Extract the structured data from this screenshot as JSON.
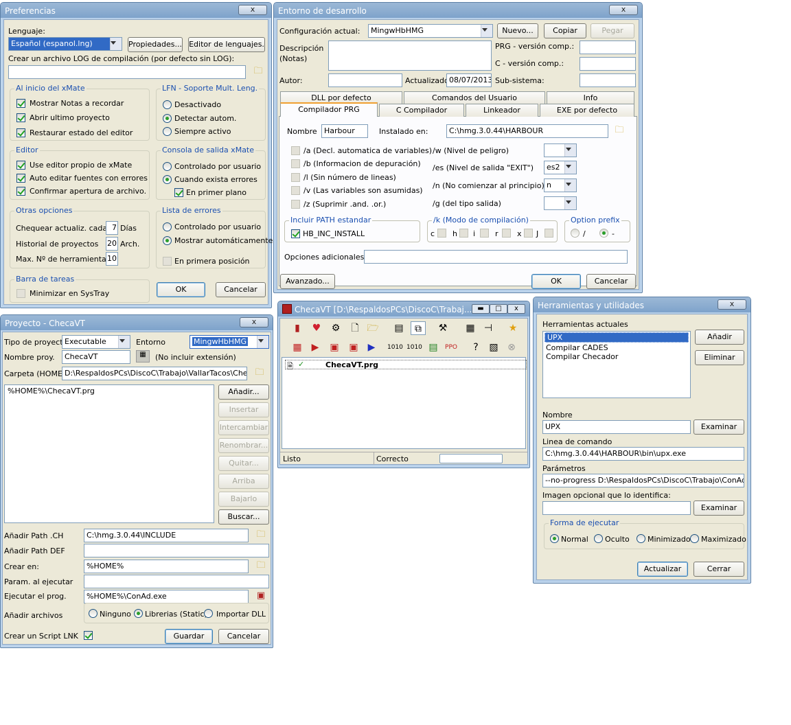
{
  "pref": {
    "title": "Preferencias",
    "close": "x",
    "lenguaje_label": "Lenguaje:",
    "lenguaje_value": "Español (espanol.lng)",
    "propiedades": "Propiedades...",
    "editor_lenguajes": "Editor de lenguajes.",
    "log_label": "Crear un archivo LOG de compilación (por defecto sin LOG):",
    "log_value": "",
    "al_inicio": {
      "title": "Al inicio del xMate",
      "items": [
        "Mostrar Notas a recordar",
        "Abrir ultimo proyecto",
        "Restaurar estado del editor"
      ]
    },
    "lfn": {
      "title": "LFN - Soporte Mult. Leng.",
      "items": [
        "Desactivado",
        "Detectar autom.",
        "Siempre activo"
      ]
    },
    "editor": {
      "title": "Editor",
      "items": [
        "Use editor propio de xMate",
        "Auto editar fuentes con errores",
        "Confirmar apertura de archivo."
      ]
    },
    "consola": {
      "title": "Consola de salida xMate",
      "items": [
        "Controlado por usuario",
        "Cuando exista errores",
        "En primer plano"
      ]
    },
    "otras": {
      "title": "Otras opciones",
      "rows": [
        {
          "label": "Chequear actualiz. cada",
          "value": "7",
          "unit": "Días"
        },
        {
          "label": "Historial de proyectos",
          "value": "20",
          "unit": "Arch."
        },
        {
          "label": "Max. Nº de herramientas",
          "value": "10",
          "unit": ""
        }
      ]
    },
    "lista": {
      "title": "Lista de errores",
      "items": [
        "Controlado por usuario",
        "Mostrar automáticamente",
        "En primera posición"
      ]
    },
    "barra": {
      "title": "Barra de tareas",
      "item": "Minimizar en SysTray"
    },
    "ok": "OK",
    "cancel": "Cancelar"
  },
  "entorno": {
    "title": "Entorno de desarrollo",
    "config_label": "Configuración actual:",
    "config_value": "MingwHbHMG",
    "nuevo": "Nuevo...",
    "copiar": "Copiar",
    "pegar": "Pegar",
    "desc_label": "Descripción\n(Notas)",
    "prg_version": "PRG - versión comp.:",
    "c_version": "C - versión comp.:",
    "autor_label": "Autor:",
    "actualizado_label": "Actualizado:",
    "actualizado_value": "08/07/2013",
    "subsistema": "Sub-sistema:",
    "tabs_row1": [
      "DLL por defecto",
      "Comandos del Usuario",
      "Info"
    ],
    "tabs_row2": [
      "Compilador PRG",
      "C Compilador",
      "Linkeador",
      "EXE por defecto"
    ],
    "nombre_label": "Nombre",
    "nombre_value": "Harbour",
    "instalado_label": "Instalado en:",
    "instalado_value": "C:\\hmg.3.0.44\\HARBOUR",
    "flags_left": [
      "/a (Decl. automatica de variables)",
      "/b (Informacion de depuración)",
      "/l (Sin número de lineas)",
      "/v (Las variables son asumidas)",
      "/z (Suprimir .and. .or.)"
    ],
    "flags_right": [
      {
        "label": "/w (Nivel de peligro)",
        "value": ""
      },
      {
        "label": "/es (Nivel de salida \"EXIT\")",
        "value": "es2"
      },
      {
        "label": "/n (No comienzar al principio)",
        "value": "n"
      },
      {
        "label": "/g (del tipo salida)",
        "value": ""
      }
    ],
    "path_title": "Incluir PATH estandar",
    "path_item": "HB_INC_INSTALL",
    "k_title": "/k (Modo de compilación)",
    "k_items": [
      "c",
      "h",
      "i",
      "r",
      "x",
      "J"
    ],
    "prefix_title": "Option prefix",
    "prefix_items": [
      "/",
      "-"
    ],
    "opciones_label": "Opciones adicionales",
    "avanzado": "Avanzado...",
    "ok": "OK",
    "cancel": "Cancelar"
  },
  "proyecto": {
    "title": "Proyecto - ChecaVT",
    "tipo_label": "Tipo de proyecto",
    "tipo_value": "Executable",
    "entorno_label": "Entorno",
    "entorno_value": "MingwHbHMG",
    "nombre_label": "Nombre proy.",
    "nombre_value": "ChecaVT",
    "no_ext": "(No incluir extensión)",
    "carpeta_label": "Carpeta (HOME):",
    "carpeta_value": "D:\\RespaldosPCs\\DiscoC\\Trabajo\\VallarTacos\\Checa",
    "files": [
      "%HOME%\\ChecaVT.prg"
    ],
    "buttons": [
      "Añadir...",
      "Insertar",
      "Intercambiar",
      "Renombrar...",
      "Quitar...",
      "Arriba",
      "Bajarlo",
      "Buscar..."
    ],
    "path_ch_label": "Añadir Path .CH",
    "path_ch_value": "C:\\hmg.3.0.44\\INCLUDE",
    "path_def_label": "Añadir Path DEF",
    "path_def_value": "",
    "crear_label": "Crear en:",
    "crear_value": "%HOME%",
    "param_label": "Param. al ejecutar",
    "param_value": "",
    "ejecutar_label": "Ejecutar el prog.",
    "ejecutar_value": "%HOME%\\ConAd.exe",
    "archivos_label": "Añadir archivos",
    "archivos_opts": [
      "Ninguno",
      "Librerias (Static)",
      "Importar DLL"
    ],
    "script_label": "Crear un Script LNK",
    "guardar": "Guardar",
    "cancel": "Cancelar"
  },
  "checavt": {
    "title": "ChecaVT [D:\\RespaldosPCs\\DiscoC\\Trabaj...",
    "file": "ChecaVT.prg",
    "status_left": "Listo",
    "status_mid": "Correcto"
  },
  "herr": {
    "title": "Herramientas y utilidades",
    "actuales_label": "Herramientas actuales",
    "items": [
      "UPX",
      "Compilar CADES",
      "Compilar Checador"
    ],
    "anadir": "Añadir",
    "eliminar": "Eliminar",
    "nombre_label": "Nombre",
    "nombre_value": "UPX",
    "examinar": "Examinar",
    "linea_label": "Linea de comando",
    "linea_value": "C:\\hmg.3.0.44\\HARBOUR\\bin\\upx.exe",
    "param_label": "Parámetros",
    "param_value": "--no-progress D:\\RespaldosPCs\\DiscoC\\Trabajo\\ConAd\\Co",
    "imagen_label": "Imagen opcional que lo identifica:",
    "imagen_value": "",
    "forma_title": "Forma de ejecutar",
    "forma_opts": [
      "Normal",
      "Oculto",
      "Minimizado",
      "Maximizado"
    ],
    "actualizar": "Actualizar",
    "cerrar": "Cerrar"
  }
}
